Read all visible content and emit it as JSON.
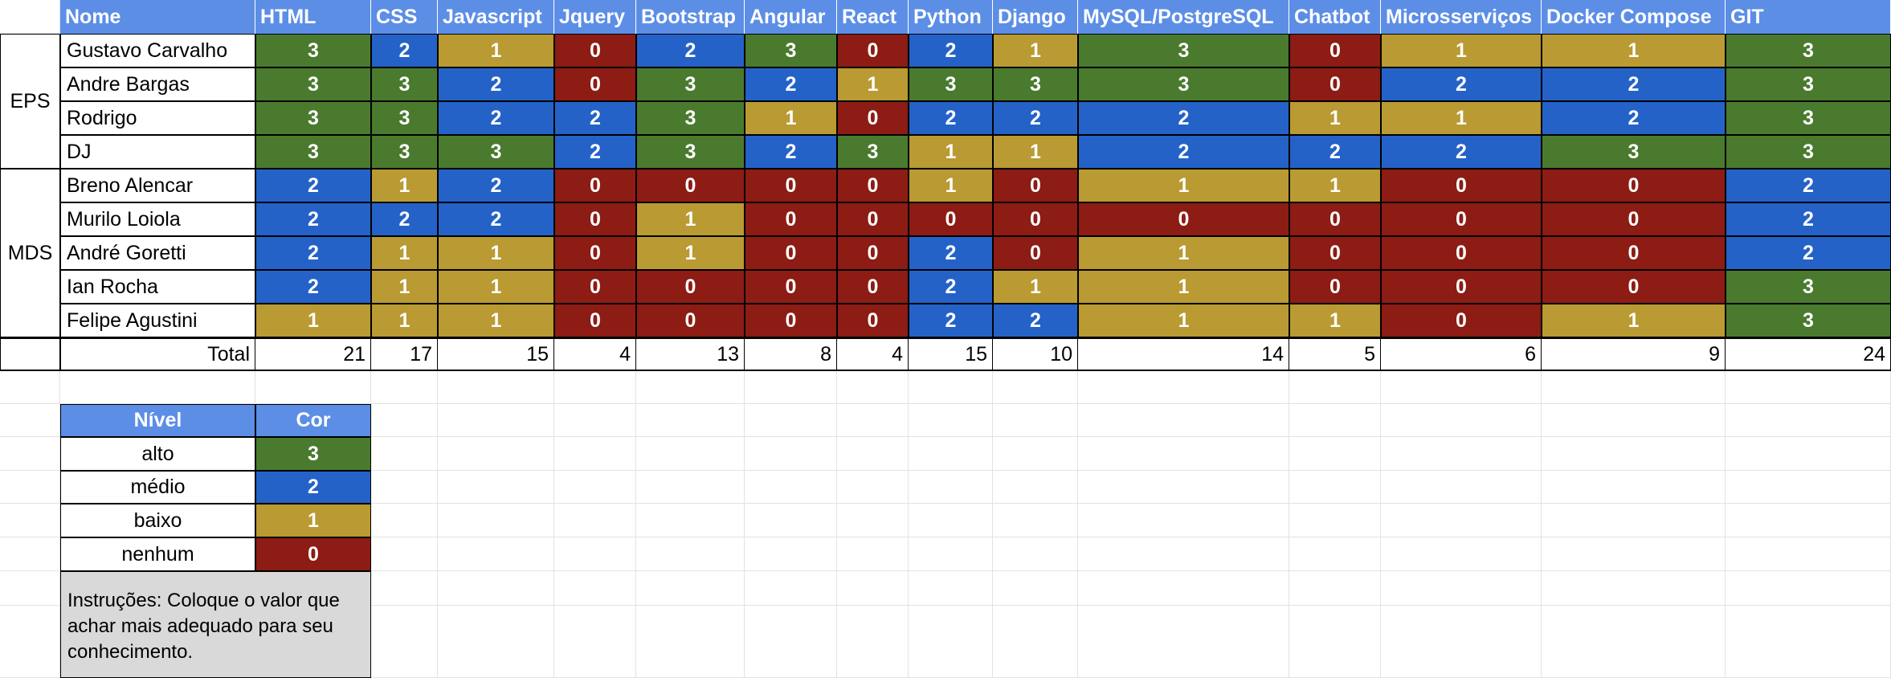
{
  "header": {
    "name_label": "Nome",
    "skills": [
      "HTML",
      "CSS",
      "Javascript",
      "Jquery",
      "Bootstrap",
      "Angular",
      "React",
      "Python",
      "Django",
      "MySQL/PostgreSQL",
      "Chatbot",
      "Microsserviços",
      "Docker Compose",
      "GIT"
    ]
  },
  "groups": [
    {
      "label": "EPS",
      "members": [
        {
          "name": "Gustavo Carvalho",
          "scores": [
            "3",
            "2",
            "1",
            "0",
            "2",
            "3",
            "0",
            "2",
            "1",
            "3",
            "0",
            "1",
            "1",
            "3"
          ]
        },
        {
          "name": "Andre Bargas",
          "scores": [
            "3",
            "3",
            "2",
            "0",
            "3",
            "2",
            "1",
            "3",
            "3",
            "3",
            "0",
            "2",
            "2",
            "3"
          ]
        },
        {
          "name": "Rodrigo",
          "scores": [
            "3",
            "3",
            "2",
            "2",
            "3",
            "1",
            "0",
            "2",
            "2",
            "2",
            "1",
            "1",
            "2",
            "3"
          ]
        },
        {
          "name": "DJ",
          "scores": [
            "3",
            "3",
            "3",
            "2",
            "3",
            "2",
            "3",
            "1",
            "1",
            "2",
            "2",
            "2",
            "3",
            "3"
          ]
        }
      ]
    },
    {
      "label": "MDS",
      "members": [
        {
          "name": "Breno Alencar",
          "scores": [
            "2",
            "1",
            "2",
            "0",
            "0",
            "0",
            "0",
            "1",
            "0",
            "1",
            "1",
            "0",
            "0",
            "2"
          ]
        },
        {
          "name": "Murilo Loiola",
          "scores": [
            "2",
            "2",
            "2",
            "0",
            "1",
            "0",
            "0",
            "0",
            "0",
            "0",
            "0",
            "0",
            "0",
            "2"
          ]
        },
        {
          "name": "André Goretti",
          "scores": [
            "2",
            "1",
            "1",
            "0",
            "1",
            "0",
            "0",
            "2",
            "0",
            "1",
            "0",
            "0",
            "0",
            "2"
          ]
        },
        {
          "name": "Ian Rocha",
          "scores": [
            "2",
            "1",
            "1",
            "0",
            "0",
            "0",
            "0",
            "2",
            "1",
            "1",
            "0",
            "0",
            "0",
            "3"
          ]
        },
        {
          "name": "Felipe Agustini",
          "scores": [
            "1",
            "1",
            "1",
            "0",
            "0",
            "0",
            "0",
            "2",
            "2",
            "1",
            "1",
            "0",
            "1",
            "3"
          ]
        }
      ]
    }
  ],
  "totals": {
    "label": "Total",
    "values": [
      "21",
      "17",
      "15",
      "4",
      "13",
      "8",
      "4",
      "15",
      "10",
      "14",
      "5",
      "6",
      "9",
      "24"
    ]
  },
  "legend": {
    "header_level": "Nível",
    "header_color": "Cor",
    "rows": [
      {
        "label": "alto",
        "value": "3"
      },
      {
        "label": "médio",
        "value": "2"
      },
      {
        "label": "baixo",
        "value": "1"
      },
      {
        "label": "nenhum",
        "value": "0"
      }
    ],
    "instructions": "Instruções: Coloque o valor que achar mais adequado para seu conhecimento."
  },
  "colors": {
    "header_blue": "#5c8ee6",
    "level_3_green": "#4a7a2e",
    "level_2_blue": "#2462c8",
    "level_1_gold": "#b99a33",
    "level_0_red": "#8c1c14",
    "note_gray": "#d9d9d9"
  }
}
